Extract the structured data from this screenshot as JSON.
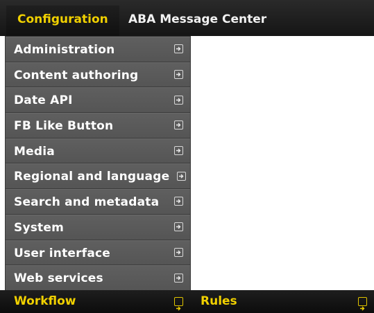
{
  "topbar": {
    "items": [
      {
        "label": "Configuration",
        "active": true
      },
      {
        "label": "ABA Message Center",
        "active": false
      }
    ]
  },
  "config_menu": {
    "items": [
      {
        "label": "Administration"
      },
      {
        "label": "Content authoring"
      },
      {
        "label": "Date API"
      },
      {
        "label": "FB Like Button"
      },
      {
        "label": "Media"
      },
      {
        "label": "Regional and language"
      },
      {
        "label": "Search and metadata"
      },
      {
        "label": "System"
      },
      {
        "label": "User interface"
      },
      {
        "label": "Web services"
      }
    ],
    "active_item": {
      "label": "Workflow"
    }
  },
  "submenu": {
    "items": [
      {
        "label": "Rules"
      }
    ]
  },
  "colors": {
    "accent": "#f0d000",
    "menu_bg": "#5a5a5a",
    "bar_bg": "#151515"
  },
  "icons": {
    "expand": "arrow-into-box-icon"
  }
}
